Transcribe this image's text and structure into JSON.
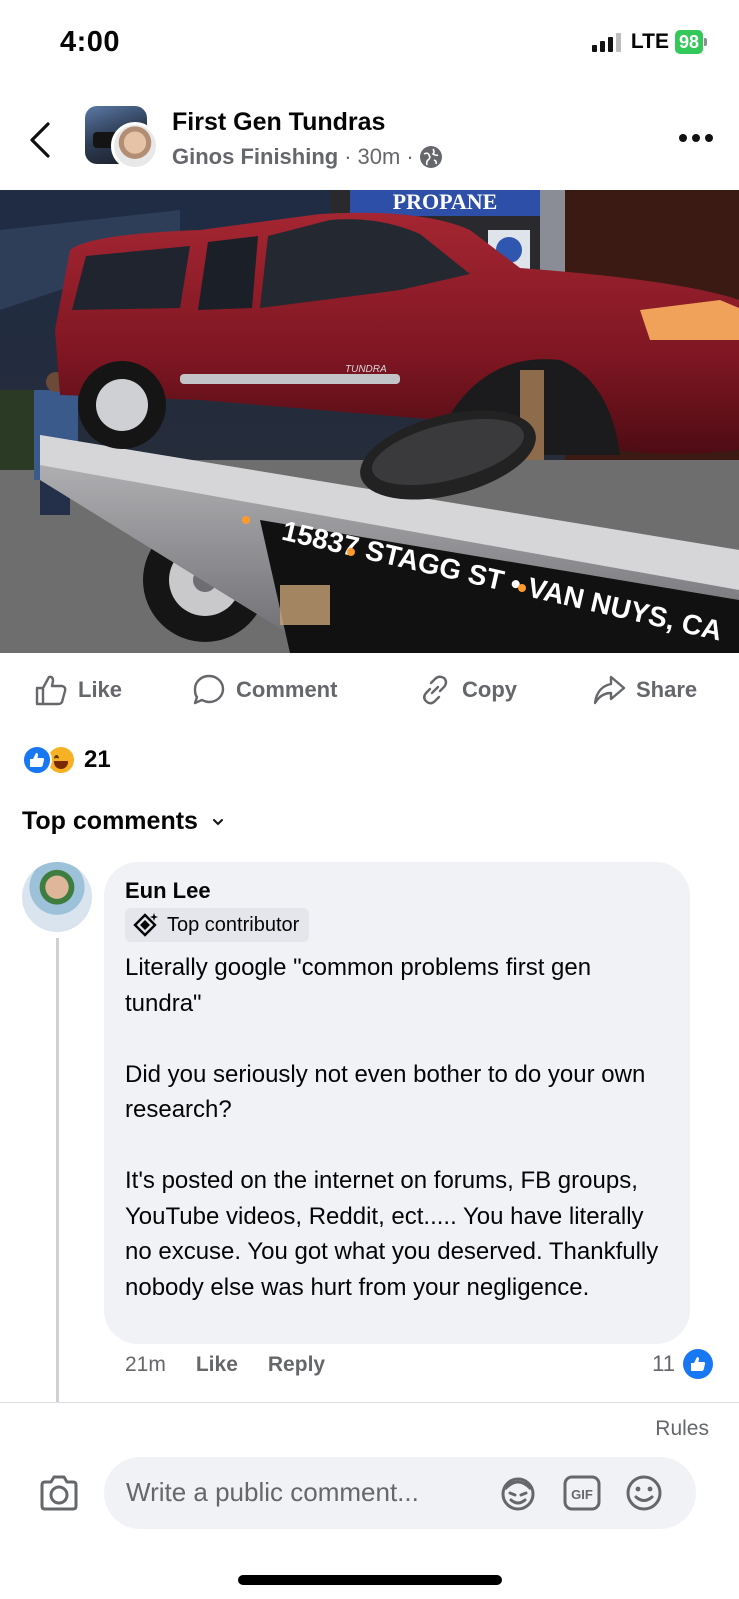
{
  "status_bar": {
    "time": "4:00",
    "network": "LTE",
    "battery": "98"
  },
  "header": {
    "group_name": "First Gen Tundras",
    "author": "Ginos Finishing",
    "time_ago": "30m",
    "separator": "·"
  },
  "photo": {
    "sign_text": "PROPANE",
    "badge_text": "TUNDRA",
    "truck_text": "15837 STAGG ST  •  VAN NUYS, CA"
  },
  "actions": {
    "like": "Like",
    "comment": "Comment",
    "copy": "Copy",
    "share": "Share"
  },
  "reactions": {
    "count": "21"
  },
  "comments_section": {
    "sort_label": "Top comments"
  },
  "comment": {
    "author": "Eun Lee",
    "badge": "Top contributor",
    "text": "Literally google \"common problems first gen tundra\"\n\nDid you seriously not even bother to do your own research?\n\nIt's posted on the internet on forums, FB groups, YouTube videos, Reddit, ect..... You have literally no excuse. You got what you deserved. Thankfully nobody else was hurt from your negligence.",
    "time_ago": "21m",
    "like_label": "Like",
    "reply_label": "Reply",
    "like_count": "11"
  },
  "composer": {
    "rules": "Rules",
    "placeholder": "Write a public comment..."
  }
}
